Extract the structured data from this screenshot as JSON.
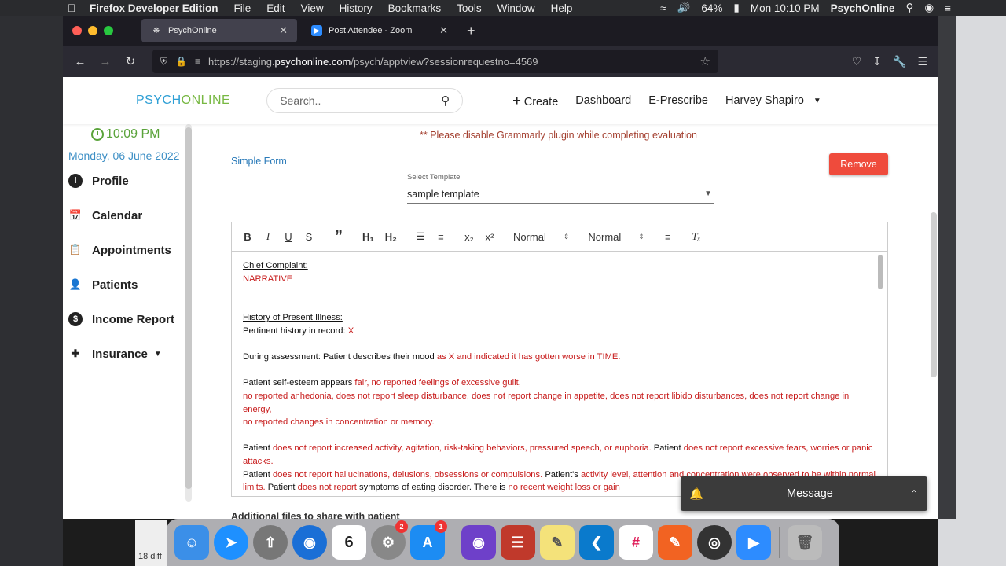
{
  "menubar": {
    "app": "Firefox Developer Edition",
    "items": [
      "File",
      "Edit",
      "View",
      "History",
      "Bookmarks",
      "Tools",
      "Window",
      "Help"
    ],
    "battery": "64%",
    "clock": "Mon 10:10 PM",
    "user": "PsychOnline"
  },
  "browser": {
    "tabs": [
      {
        "title": "PsychOnline",
        "active": true
      },
      {
        "title": "Post Attendee - Zoom",
        "active": false
      }
    ],
    "url_prefix": "https://staging.",
    "url_host": "psychonline.com",
    "url_path": "/psych/apptview?sessionrequestno=4569"
  },
  "header": {
    "logo_part1": "PSYCH",
    "logo_part2": "ONLINE",
    "search_placeholder": "Search..",
    "nav": {
      "create": "Create",
      "dashboard": "Dashboard",
      "eprescribe": "E-Prescribe",
      "user": "Harvey Shapiro"
    }
  },
  "sidebar": {
    "time": "10:09 PM",
    "date": "Monday, 06 June 2022",
    "items": [
      {
        "label": "Profile",
        "icon": "info-icon"
      },
      {
        "label": "Calendar",
        "icon": "calendar-icon"
      },
      {
        "label": "Appointments",
        "icon": "clipboard-icon"
      },
      {
        "label": "Patients",
        "icon": "person-icon"
      },
      {
        "label": "Income Report",
        "icon": "dollar-icon"
      },
      {
        "label": "Insurance",
        "icon": "medical-bag-icon"
      }
    ]
  },
  "main": {
    "warning": "** Please disable Grammarly plugin while completing evaluation",
    "form_title": "Simple Form",
    "remove_label": "Remove",
    "template_label": "Select Template",
    "template_value": "sample template",
    "toolbar": {
      "bold": "B",
      "italic": "I",
      "underline": "U",
      "strike": "S",
      "quote": "”",
      "h1": "H₁",
      "h2": "H₂",
      "sub": "x₂",
      "sup": "x²",
      "font_size_1": "Normal",
      "font_size_2": "Normal"
    },
    "editor": {
      "cc_heading": "Chief Complaint:",
      "cc_value": "NARRATIVE",
      "hpi_heading": "History of Present Illness:",
      "pertinent": "Pertinent history in record: ",
      "pertinent_x": "X",
      "assess_a": "During assessment: Patient describes their mood ",
      "assess_b": "as X and indicated it has gotten worse in TIME.",
      "esteem_a": "Patient self-esteem appears ",
      "esteem_b": "fair, no reported feelings of excessive guilt,",
      "esteem_c": "no reported anhedonia, does not report sleep disturbance,  does not report change in appetite,  does not report libido disturbances, does not report change in energy,",
      "esteem_d": "no reported changes in concentration or memory.",
      "p1_a": "Patient ",
      "p1_b": "does not report increased activity, agitation, risk-taking behaviors, pressured speech, or euphoria.",
      "p1_c": "  Patient ",
      "p1_d": "does not report excessive fears, worries or panic attacks.",
      "p2_a": "Patient ",
      "p2_b": "does not report hallucinations, delusions, obsessions or compulsions.",
      "p2_c": "  Patient's ",
      "p2_d": "activity level, attention and concentration were observed to be within normal limits.",
      "p2_e": " Patient ",
      "p2_f": "does not report",
      "p2_g": " symptoms of eating disorder. There is ",
      "p2_h": "no recent weight loss or gain"
    },
    "additional_files": "Additional files to share with patient"
  },
  "message_widget": {
    "label": "Message"
  },
  "dock": {
    "calendar_day": "6",
    "settings_badge": "2",
    "appstore_badge": "1"
  },
  "desktop": {
    "left_note": "18 diff"
  }
}
